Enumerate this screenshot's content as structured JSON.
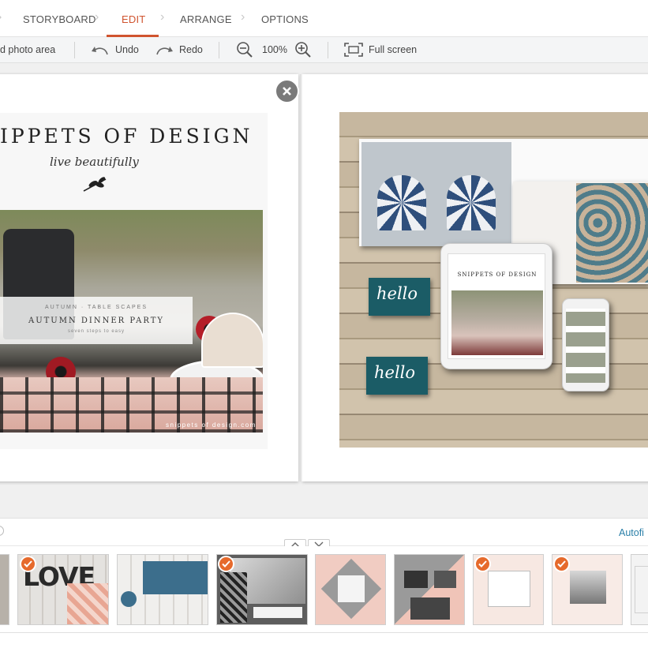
{
  "nav": {
    "tabs": [
      "STORYBOARD",
      "EDIT",
      "ARRANGE",
      "OPTIONS"
    ],
    "active": "EDIT"
  },
  "toolbar": {
    "add_photo_area": "d photo area",
    "undo": "Undo",
    "redo": "Redo",
    "zoom": "100%",
    "full_screen": "Full screen"
  },
  "left_page": {
    "brand": "IPPETS OF DESIGN",
    "tagline": "live beautifully",
    "overlay": {
      "eyebrow": "AUTUMN · TABLE SCAPES",
      "title": "AUTUMN DINNER PARTY",
      "note": "seven steps to easy"
    },
    "url": "snippets of design.com"
  },
  "right_page": {
    "card_text_1": "hello",
    "card_text_2": "hello",
    "tablet_brand": "SNIPPETS OF DESIGN"
  },
  "strip": {
    "autofill": "Autofi",
    "up_icon": "chevron-up-icon",
    "down_icon": "chevron-down-icon",
    "thumbs": [
      {
        "label": "thumb-1",
        "checked": false
      },
      {
        "label": "LOVE",
        "checked": true
      },
      {
        "label": "sailboat",
        "checked": false
      },
      {
        "label": "baby",
        "checked": true
      },
      {
        "label": "thumb-5",
        "checked": false
      },
      {
        "label": "thumb-6",
        "checked": false
      },
      {
        "label": "thumb-7",
        "checked": true
      },
      {
        "label": "thumb-8",
        "checked": true
      },
      {
        "label": "thumb-9",
        "checked": false
      }
    ]
  },
  "colors": {
    "accent": "#d0542f",
    "check": "#e66a2c",
    "link": "#2a7fa8",
    "card": "#1b5c66"
  }
}
